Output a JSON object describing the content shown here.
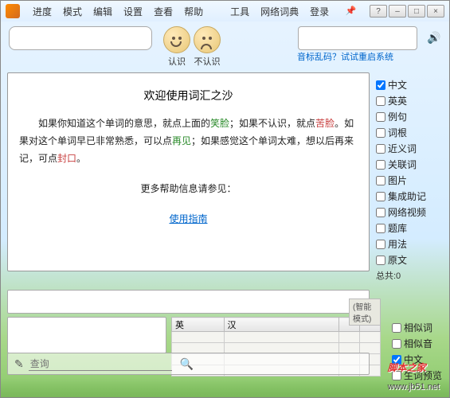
{
  "menu": {
    "items": [
      "进度",
      "模式",
      "编辑",
      "设置",
      "查看",
      "帮助"
    ],
    "items2": [
      "工具",
      "网络词典",
      "登录"
    ]
  },
  "winbtns": {
    "help": "?",
    "min": "–",
    "max": "□",
    "close": "×"
  },
  "faces": {
    "know": "认识",
    "dontknow": "不认识"
  },
  "hint": "音标乱码？试试重启系统",
  "welcome": {
    "title": "欢迎使用词汇之沙",
    "p1a": "如果你知道这个单词的意思，就点上面的",
    "p1b": "笑脸",
    "p1c": "；如果不认识，就点",
    "p1d": "苦脸",
    "p1e": "。如果对这个单词早已非常熟悉，可以点",
    "p1f": "再见",
    "p1g": "；如果感觉这个单词太难，想以后再来记，可点",
    "p1h": "封口",
    "p1i": "。",
    "more": "更多帮助信息请参见：",
    "guide": "使用指南"
  },
  "sidebar": {
    "items": [
      "中文",
      "英英",
      "例句",
      "词根",
      "近义词",
      "关联词",
      "图片",
      "集成助记",
      "网络视频",
      "题库",
      "用法",
      "原文"
    ],
    "checked": [
      true,
      false,
      false,
      false,
      false,
      false,
      false,
      false,
      false,
      false,
      false,
      false
    ],
    "total": "总共:0"
  },
  "table": {
    "cols": [
      "英",
      "汉",
      "",
      ""
    ]
  },
  "sidebar2": {
    "items": [
      "相似词",
      "相似音",
      "中文",
      "生词预览"
    ],
    "checked": [
      false,
      false,
      true,
      false
    ]
  },
  "smart": "(智能模式)",
  "bottom": {
    "placeholder": "查询"
  },
  "watermark": {
    "main": "脚本之家",
    "sub": "www.jb51.net"
  }
}
